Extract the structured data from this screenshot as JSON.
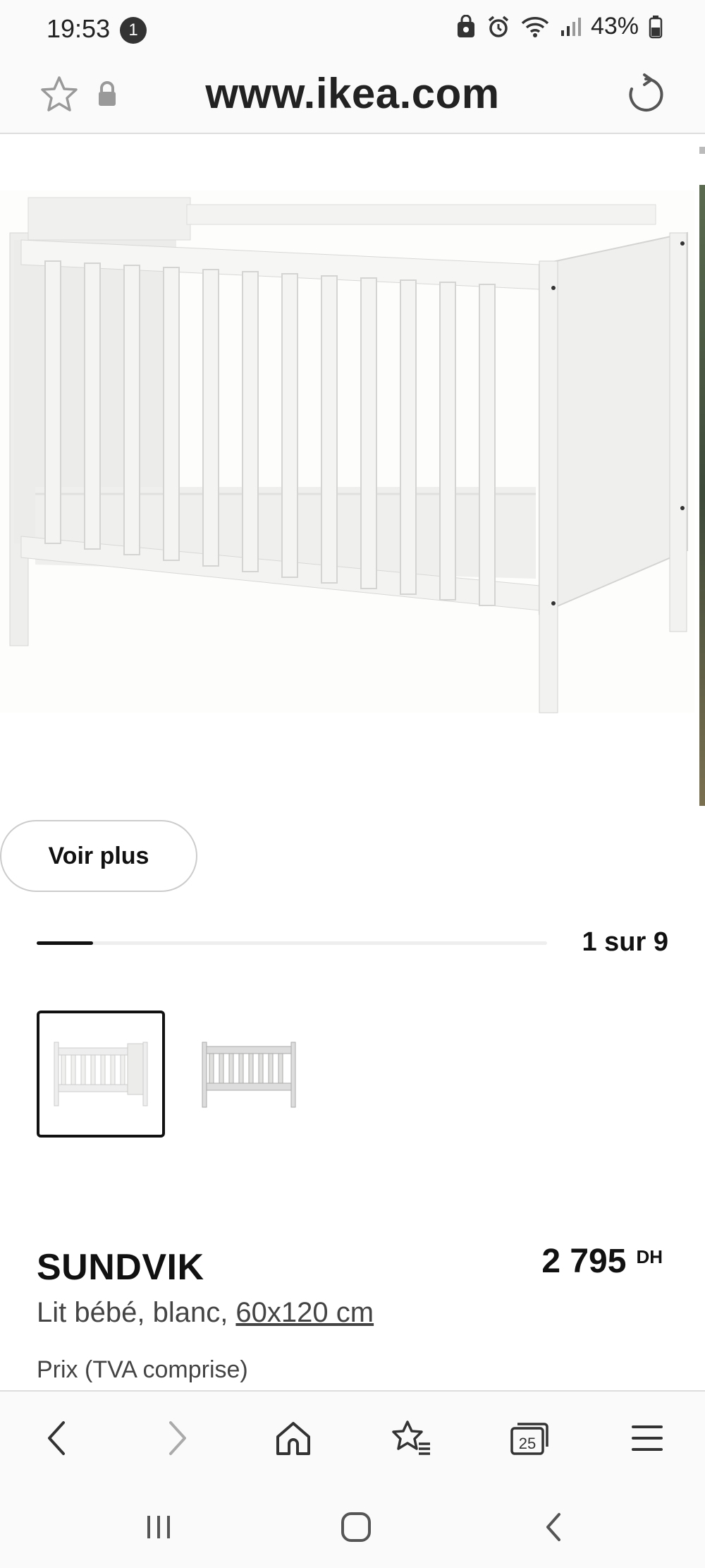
{
  "status_bar": {
    "time": "19:53",
    "notification_count": "1",
    "battery_percent": "43%"
  },
  "url_bar": {
    "url": "www.ikea.com"
  },
  "gallery": {
    "see_more_label": "Voir plus",
    "position_label": "1 sur 9",
    "progress": 0.11,
    "thumbnails": [
      {
        "name": "crib-front-view",
        "selected": true
      },
      {
        "name": "crib-grey-view",
        "selected": false
      }
    ]
  },
  "product": {
    "name": "SUNDVIK",
    "price_amount": "2 795",
    "price_currency": "DH",
    "description_prefix": "Lit bébé, blanc, ",
    "description_size": "60x120 cm",
    "price_note": "Prix (TVA comprise)"
  },
  "browser_toolbar": {
    "tab_count": "25",
    "icons": [
      "back-icon",
      "forward-icon",
      "home-icon",
      "bookmarks-icon",
      "tabs-icon",
      "menu-icon"
    ]
  },
  "android_nav": {
    "icons": [
      "recents-icon",
      "home-nav-icon",
      "back-nav-icon"
    ]
  },
  "colors": {
    "text": "#111111",
    "muted_text": "#444444",
    "bar_background": "#fafafa"
  }
}
